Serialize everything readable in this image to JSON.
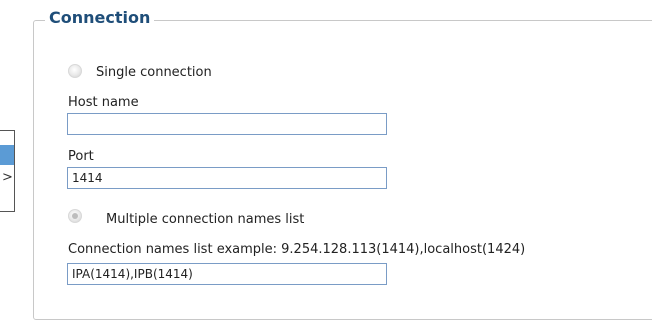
{
  "connection": {
    "legend": "Connection",
    "single_connection_label": "Single connection",
    "host_name_label": "Host name",
    "host_name_value": "",
    "port_label": "Port",
    "port_value": "1414",
    "multiple_connection_label": "Multiple connection names list",
    "conn_names_example": "Connection names list example: 9.254.128.113(1414),localhost(1424)",
    "conn_names_value": "IPA(1414),IPB(1414)",
    "mode_selected": "multiple"
  },
  "left_panel": {
    "chevron": ">"
  }
}
